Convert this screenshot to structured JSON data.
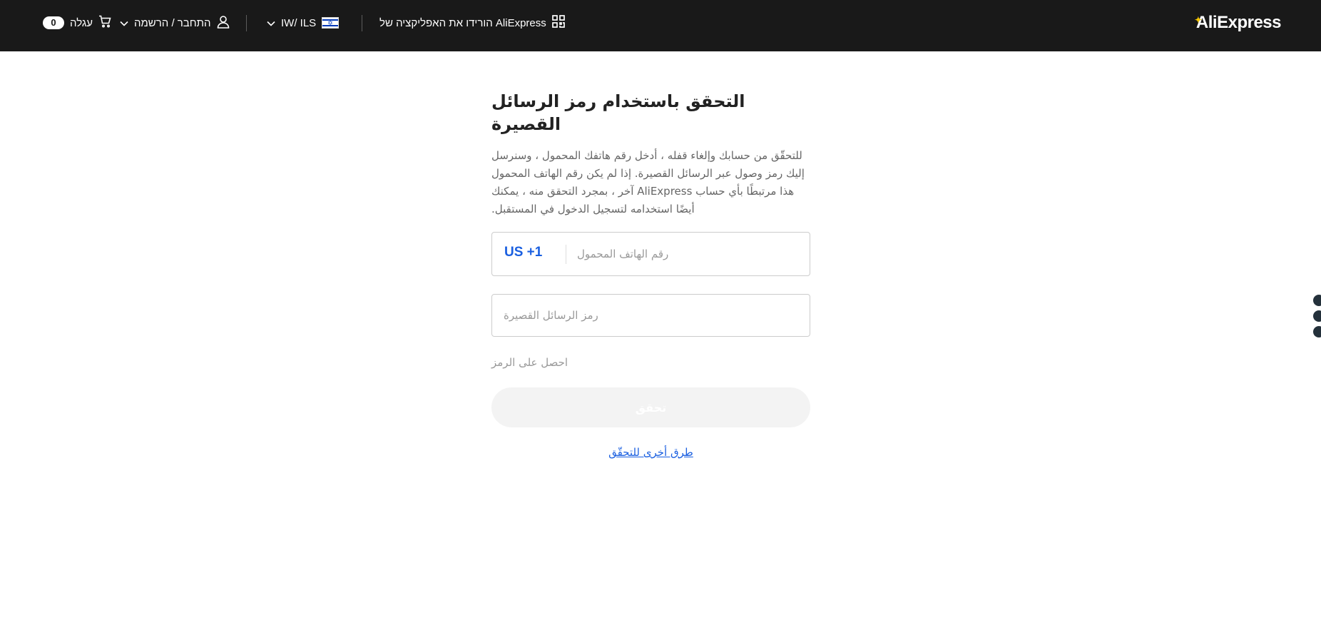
{
  "header": {
    "logo_text": "AliExpress",
    "app_download": {
      "label": "הורידו את האפליקציה של AliExpress",
      "icon": "qr-code-icon"
    },
    "locale": {
      "label": "IW/ ILS",
      "flag": "israel-flag-icon",
      "chevron": "chevron-down-icon"
    },
    "account": {
      "label": "התחבר / הרשמה",
      "icon": "user-icon",
      "chevron": "chevron-down-icon"
    },
    "cart": {
      "label": "עגלה",
      "count": "0",
      "icon": "cart-icon"
    }
  },
  "verification": {
    "title": "التحقق باستخدام رمز الرسائل القصيرة",
    "description": "للتحقّق من حسابك وإلغاء قفله ، أدخل رقم هاتفك المحمول ، وسنرسل إليك رمز وصول عبر الرسائل القصيرة. إذا لم يكن رقم الهاتف المحمول هذا مرتبطًا بأي حساب AliExpress آخر ، بمجرد التحقق منه ، يمكنك أيضًا استخدامه لتسجيل الدخول في المستقبل.",
    "phone": {
      "country_code": "US +1",
      "placeholder": "رقم الهاتف المحمول",
      "value": ""
    },
    "sms": {
      "placeholder": "رمز الرسائل القصيرة",
      "value": ""
    },
    "get_code_label": "احصل على الرمز",
    "verify_button_label": "تحقق",
    "other_ways_label": "طرق أخرى للتحقّق"
  },
  "colors": {
    "header_bg": "#191919",
    "link_blue": "#1a5fe0",
    "disabled_button_bg": "#f3f3f3",
    "side_dots": "#24313b"
  }
}
